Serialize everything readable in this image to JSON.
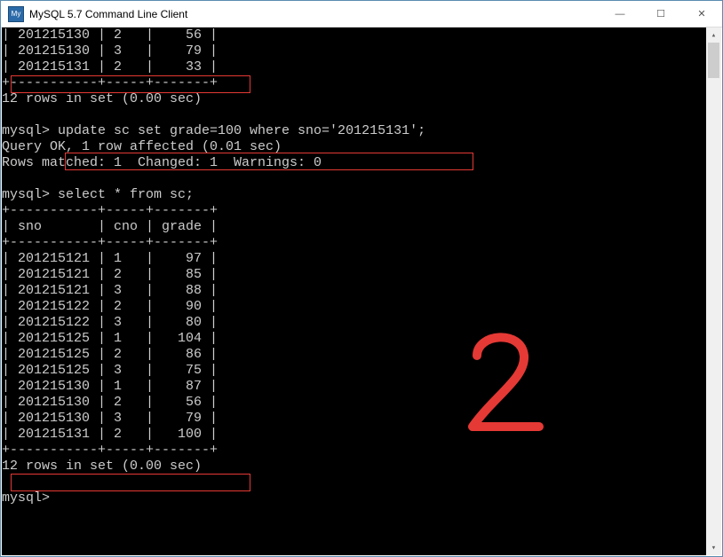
{
  "window": {
    "title": "MySQL 5.7 Command Line Client",
    "icon_label": "MySQL"
  },
  "prompt": "mysql>",
  "top_rows": [
    {
      "sno": "201215130",
      "cno": "2",
      "grade": "56"
    },
    {
      "sno": "201215130",
      "cno": "3",
      "grade": "79"
    },
    {
      "sno": "201215131",
      "cno": "2",
      "grade": "33"
    }
  ],
  "top_summary": "12 rows in set (0.00 sec)",
  "update_cmd": "update sc set grade=100 where sno='201215131';",
  "update_result_1": "Query OK, 1 row affected (0.01 sec)",
  "update_result_2": "Rows matched: 1  Changed: 1  Warnings: 0",
  "select_cmd": "select * from sc;",
  "headers": {
    "sno": "sno",
    "cno": "cno",
    "grade": "grade"
  },
  "rows": [
    {
      "sno": "201215121",
      "cno": "1",
      "grade": "97"
    },
    {
      "sno": "201215121",
      "cno": "2",
      "grade": "85"
    },
    {
      "sno": "201215121",
      "cno": "3",
      "grade": "88"
    },
    {
      "sno": "201215122",
      "cno": "2",
      "grade": "90"
    },
    {
      "sno": "201215122",
      "cno": "3",
      "grade": "80"
    },
    {
      "sno": "201215125",
      "cno": "1",
      "grade": "104"
    },
    {
      "sno": "201215125",
      "cno": "2",
      "grade": "86"
    },
    {
      "sno": "201215125",
      "cno": "3",
      "grade": "75"
    },
    {
      "sno": "201215130",
      "cno": "1",
      "grade": "87"
    },
    {
      "sno": "201215130",
      "cno": "2",
      "grade": "56"
    },
    {
      "sno": "201215130",
      "cno": "3",
      "grade": "79"
    },
    {
      "sno": "201215131",
      "cno": "2",
      "grade": "100"
    }
  ],
  "bot_summary": "12 rows in set (0.00 sec)",
  "ruler": "+-----------+-----+-------+",
  "annotation": {
    "label": "2"
  }
}
